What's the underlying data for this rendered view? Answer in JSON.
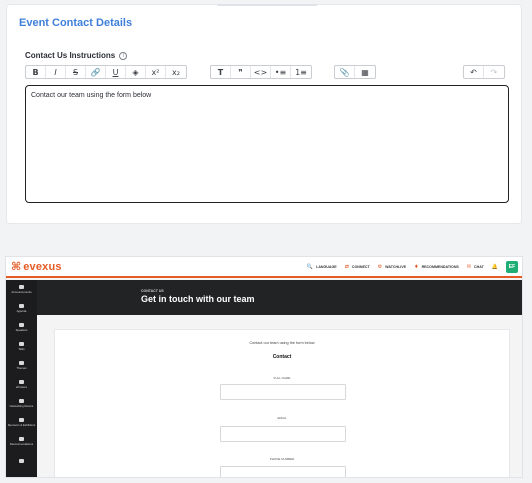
{
  "editor_card": {
    "title": "Event Contact Details",
    "field_label": "Contact Us Instructions",
    "info_icon": "info-icon",
    "toolbar": {
      "format_group": [
        "B",
        "I",
        "S",
        "🔗",
        "U",
        "◈",
        "x²",
        "x₂"
      ],
      "block_group": [
        "T",
        "❞",
        "<>",
        "•≡",
        "1≡"
      ],
      "insert_group": [
        "📎",
        "▦"
      ],
      "history_group": [
        "↶",
        "↷"
      ]
    },
    "content": "Contact our team using the form below"
  },
  "preview": {
    "logo_mark": "⌘",
    "logo_text": "evexus",
    "nav": [
      {
        "icon": "🔍",
        "label": "LANGUAGE"
      },
      {
        "icon": "⇄",
        "label": "CONNECT"
      },
      {
        "icon": "⚙",
        "label": "WATCHLIVE"
      },
      {
        "icon": "♦",
        "label": "RECOMMENDATIONS"
      },
      {
        "icon": "✉",
        "label": "CHAT"
      },
      {
        "icon": "🔔",
        "label": ""
      }
    ],
    "avatar": "EF",
    "sidebar": [
      "Announcements",
      "Agenda",
      "Speakers",
      "Talks",
      "Themes",
      "ePosters",
      "Networking Rooms",
      "Sponsors & Exhibitors",
      "Recommendations",
      ""
    ],
    "hero": {
      "eyebrow": "CONTACT US",
      "title": "Get in touch with our team"
    },
    "form": {
      "intro": "Contact our team using the form below",
      "heading": "Contact",
      "fields": [
        "FULL NAME",
        "EMAIL",
        "PHONE NUMBER"
      ]
    }
  }
}
